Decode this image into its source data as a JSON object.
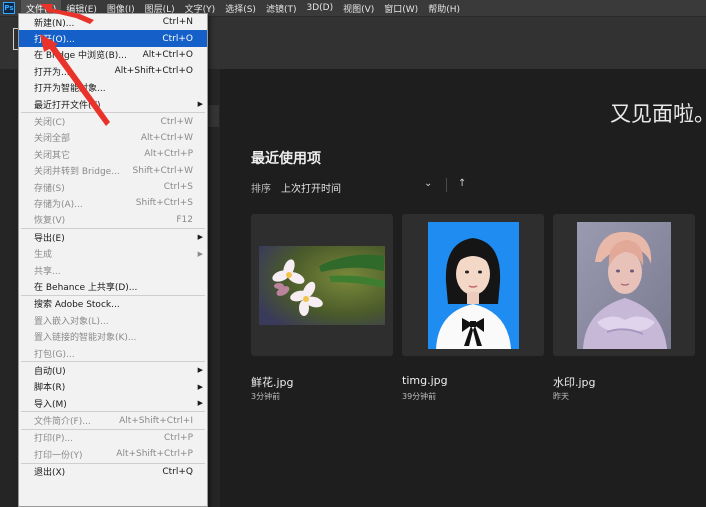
{
  "app": {
    "logo": "Ps"
  },
  "menubar": {
    "items": [
      {
        "label": "文件(F)",
        "active": true
      },
      {
        "label": "编辑(E)"
      },
      {
        "label": "图像(I)"
      },
      {
        "label": "图层(L)"
      },
      {
        "label": "文字(Y)"
      },
      {
        "label": "选择(S)"
      },
      {
        "label": "滤镜(T)"
      },
      {
        "label": "3D(D)"
      },
      {
        "label": "视图(V)"
      },
      {
        "label": "窗口(W)"
      },
      {
        "label": "帮助(H)"
      }
    ]
  },
  "file_menu": {
    "items": [
      {
        "label": "新建(N)...",
        "shortcut": "Ctrl+N"
      },
      {
        "label": "打开(O)...",
        "shortcut": "Ctrl+O",
        "highlight": true
      },
      {
        "label": "在 Bridge 中浏览(B)...",
        "shortcut": "Alt+Ctrl+O"
      },
      {
        "label": "打开为...",
        "shortcut": "Alt+Shift+Ctrl+O"
      },
      {
        "label": "打开为智能对象..."
      },
      {
        "label": "最近打开文件(T)",
        "submenu": true
      },
      {
        "separator": true
      },
      {
        "label": "关闭(C)",
        "shortcut": "Ctrl+W",
        "disabled": true
      },
      {
        "label": "关闭全部",
        "shortcut": "Alt+Ctrl+W",
        "disabled": true
      },
      {
        "label": "关闭其它",
        "shortcut": "Alt+Ctrl+P",
        "disabled": true
      },
      {
        "label": "关闭并转到 Bridge...",
        "shortcut": "Shift+Ctrl+W",
        "disabled": true
      },
      {
        "label": "存储(S)",
        "shortcut": "Ctrl+S",
        "disabled": true
      },
      {
        "label": "存储为(A)...",
        "shortcut": "Shift+Ctrl+S",
        "disabled": true
      },
      {
        "label": "恢复(V)",
        "shortcut": "F12",
        "disabled": true
      },
      {
        "separator": true
      },
      {
        "label": "导出(E)",
        "submenu": true
      },
      {
        "label": "生成",
        "submenu": true,
        "disabled": true
      },
      {
        "label": "共享...",
        "disabled": true
      },
      {
        "label": "在 Behance 上共享(D)..."
      },
      {
        "separator": true
      },
      {
        "label": "搜索 Adobe Stock..."
      },
      {
        "label": "置入嵌入对象(L)...",
        "disabled": true
      },
      {
        "label": "置入链接的智能对象(K)...",
        "disabled": true
      },
      {
        "label": "打包(G)...",
        "disabled": true
      },
      {
        "separator": true
      },
      {
        "label": "自动(U)",
        "submenu": true
      },
      {
        "label": "脚本(R)",
        "submenu": true
      },
      {
        "label": "导入(M)",
        "submenu": true
      },
      {
        "separator": true
      },
      {
        "label": "文件简介(F)...",
        "shortcut": "Alt+Shift+Ctrl+I",
        "disabled": true
      },
      {
        "separator": true
      },
      {
        "label": "打印(P)...",
        "shortcut": "Ctrl+P",
        "disabled": true
      },
      {
        "label": "打印一份(Y)",
        "shortcut": "Alt+Shift+Ctrl+P",
        "disabled": true
      },
      {
        "separator": true
      },
      {
        "label": "退出(X)",
        "shortcut": "Ctrl+Q"
      }
    ]
  },
  "home": {
    "greeting": "又见面啦。",
    "recent_title": "最近使用项",
    "sort_label": "排序",
    "sort_value": "上次打开时间",
    "sort_chevron": "⌄",
    "sort_arrow": "↑"
  },
  "recent_files": [
    {
      "name": "鲜花.jpg",
      "time": "3分钟前"
    },
    {
      "name": "timg.jpg",
      "time": "39分钟前"
    },
    {
      "name": "水印.jpg",
      "time": "昨天"
    }
  ],
  "colors": {
    "highlight": "#1460c8",
    "annotation_arrow": "#e8322a",
    "id_photo_bg": "#1e8cf0"
  }
}
